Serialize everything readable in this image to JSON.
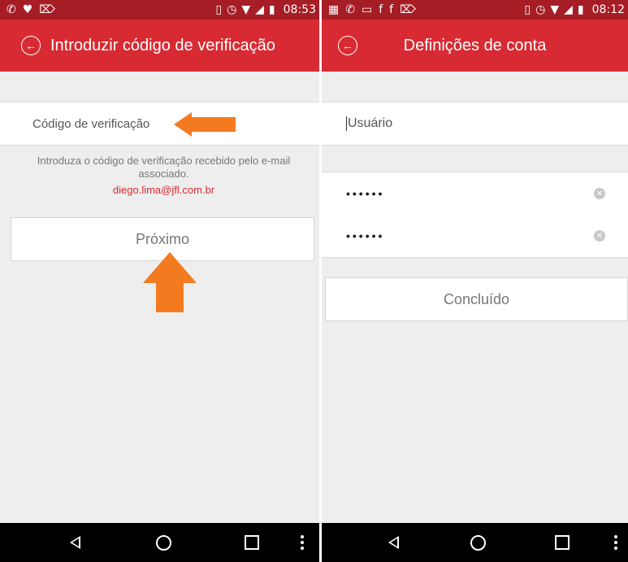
{
  "left_screen": {
    "status_bar": {
      "time": "08:53",
      "left_icons": [
        "whatsapp-icon",
        "fox-icon",
        "cursor-icon"
      ],
      "right_icons": [
        "vibrate-icon",
        "alarm-icon",
        "wifi-icon",
        "signal-icon",
        "battery-icon"
      ]
    },
    "app_bar": {
      "title": "Introduzir código de verificação"
    },
    "field": {
      "label": "Código de verificação"
    },
    "info": {
      "text": "Introduza o código de verificação recebido pelo e-mail associado.",
      "email": "diego.lima@jfl.com.br"
    },
    "button": {
      "label": "Próximo"
    },
    "annotations": {
      "arrow_color": "#f47a20"
    }
  },
  "right_screen": {
    "status_bar": {
      "time": "08:12",
      "left_icons": [
        "gallery-icon",
        "whatsapp-icon",
        "image-icon",
        "facebook-icon",
        "facebook-icon",
        "cursor-icon"
      ],
      "right_icons": [
        "vibrate-icon",
        "alarm-icon",
        "wifi-icon",
        "signal-icon",
        "battery-icon"
      ]
    },
    "app_bar": {
      "title": "Definições de conta"
    },
    "username": {
      "placeholder": "Usuário"
    },
    "password1": {
      "value": "••••••"
    },
    "password2": {
      "value": "••••••"
    },
    "button": {
      "label": "Concluído"
    }
  },
  "colors": {
    "status_bar": "#a61d25",
    "app_bar": "#d82a32",
    "background": "#eeeeee",
    "accent_text": "#d82a32"
  }
}
